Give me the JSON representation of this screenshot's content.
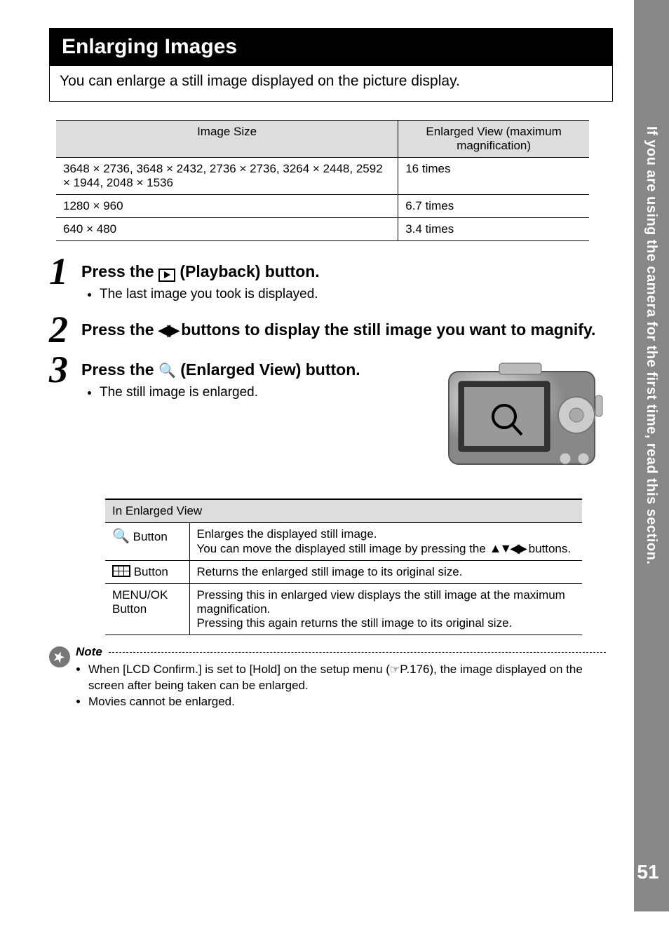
{
  "sidebar": {
    "text": "If you are using the camera for the first time, read this section.",
    "page": "51"
  },
  "title": "Enlarging Images",
  "subtitle": "You can enlarge a still image displayed on the picture display.",
  "sizes_table": {
    "headers": [
      "Image Size",
      "Enlarged View (maximum magnification)"
    ],
    "rows": [
      [
        "3648 × 2736, 3648 × 2432, 2736 × 2736, 3264 × 2448, 2592 × 1944, 2048 × 1536",
        "16 times"
      ],
      [
        "1280 × 960",
        "6.7 times"
      ],
      [
        "640 × 480",
        "3.4 times"
      ]
    ]
  },
  "steps": [
    {
      "num": "1",
      "title_pre": "Press the ",
      "title_post": " (Playback) button.",
      "bullets": [
        "The last image you took is displayed."
      ]
    },
    {
      "num": "2",
      "title_pre": "Press the ",
      "title_post": " buttons to display the still image you want to magnify."
    },
    {
      "num": "3",
      "title_pre": "Press the ",
      "title_post": " (Enlarged View) button.",
      "bullets": [
        "The still image is enlarged."
      ]
    }
  ],
  "enlarged_table": {
    "header": "In Enlarged View",
    "rows": [
      {
        "label_suffix": " Button",
        "desc1": "Enlarges the displayed still image.",
        "desc2_pre": "You can move the displayed still image by pressing the ",
        "desc2_post": " buttons."
      },
      {
        "label_suffix": " Button",
        "desc": "Returns the enlarged still image to its original size."
      },
      {
        "label": "MENU/OK Button",
        "desc1": "Pressing this in enlarged view displays the still image at the maximum magnification.",
        "desc2": "Pressing this again returns the still image to its original size."
      }
    ]
  },
  "note": {
    "title": "Note",
    "items": [
      {
        "pre": "When [LCD Confirm.] is set to [Hold] on the setup menu (",
        "post": "P.176), the image displayed on the screen after being taken can be enlarged."
      },
      {
        "text": "Movies cannot be enlarged."
      }
    ]
  },
  "chart_data": {
    "type": "table",
    "title": "Maximum enlargement by image size",
    "columns": [
      "Image Size",
      "Enlarged View (maximum magnification)"
    ],
    "rows": [
      {
        "image_size": "3648 × 2736, 3648 × 2432, 2736 × 2736, 3264 × 2448, 2592 × 1944, 2048 × 1536",
        "magnification": "16 times"
      },
      {
        "image_size": "1280 × 960",
        "magnification": "6.7 times"
      },
      {
        "image_size": "640 × 480",
        "magnification": "3.4 times"
      }
    ]
  }
}
